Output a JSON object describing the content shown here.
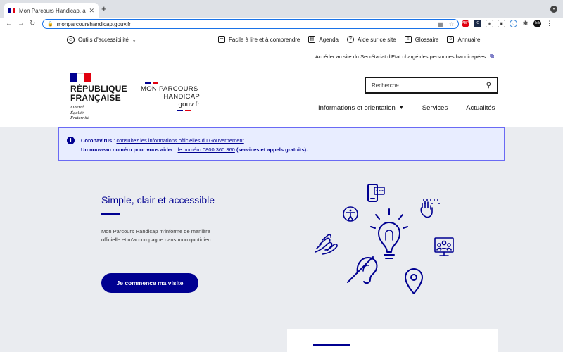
{
  "browser": {
    "tab_title": "Mon Parcours Handicap, au se",
    "tab_close": "✕",
    "new_tab": "+",
    "url": "monparcourshandicap.gouv.fr",
    "ext_badges": {
      "ext1": "ABP",
      "ext2": "IC",
      "profile": "lolk"
    }
  },
  "header": {
    "a11y_tools": "Outils d'accessibilité",
    "utility_links": [
      {
        "label": "Facile à lire et à comprendre",
        "icon": "easy-read-icon"
      },
      {
        "label": "Agenda",
        "icon": "calendar-icon"
      },
      {
        "label": "Aide sur ce site",
        "icon": "help-icon"
      },
      {
        "label": "Glossaire",
        "icon": "book-icon"
      },
      {
        "label": "Annuaire",
        "icon": "directory-icon"
      }
    ],
    "secretariat_link": "Accéder au site du Secrétariat d'État chargé des personnes handicapées",
    "rf_name_line1": "RÉPUBLIQUE",
    "rf_name_line2": "FRANÇAISE",
    "rf_motto": [
      "Liberté",
      "Égalité",
      "Fraternité"
    ],
    "service_logo": {
      "line1": "MON PARCOURS",
      "line2": "HANDICAP",
      "line3": ".gouv.fr"
    },
    "search_placeholder": "Recherche",
    "nav": [
      {
        "label": "Informations et orientation",
        "has_dropdown": true
      },
      {
        "label": "Services"
      },
      {
        "label": "Actualités"
      }
    ]
  },
  "notice": {
    "line1_bold": "Coronavirus",
    "line1_sep": " : ",
    "line1_link": "consultez les informations officielles du Gouvernement",
    "line1_end": ".",
    "line2_text": "Un nouveau numéro pour vous aider : ",
    "line2_link": "le numéro 0800 360 360",
    "line2_end": " (services et appels gratuits)."
  },
  "hero": {
    "title": "Simple, clair et accessible",
    "text": "Mon Parcours Handicap m'informe de manière officielle et m'accompagne dans mon quotidien.",
    "cta": "Je commence ma visite"
  },
  "colors": {
    "primary": "#000091",
    "france_red": "#e1000f",
    "notice_bg": "#e8edff",
    "page_bg": "#eaecf0"
  },
  "illustration_icons": [
    "phone-chat-icon",
    "braille-hand-icon",
    "accessibility-person-icon",
    "lightbulb-icon",
    "sign-language-icon",
    "video-conference-icon",
    "hearing-loop-icon",
    "location-pin-icon"
  ]
}
